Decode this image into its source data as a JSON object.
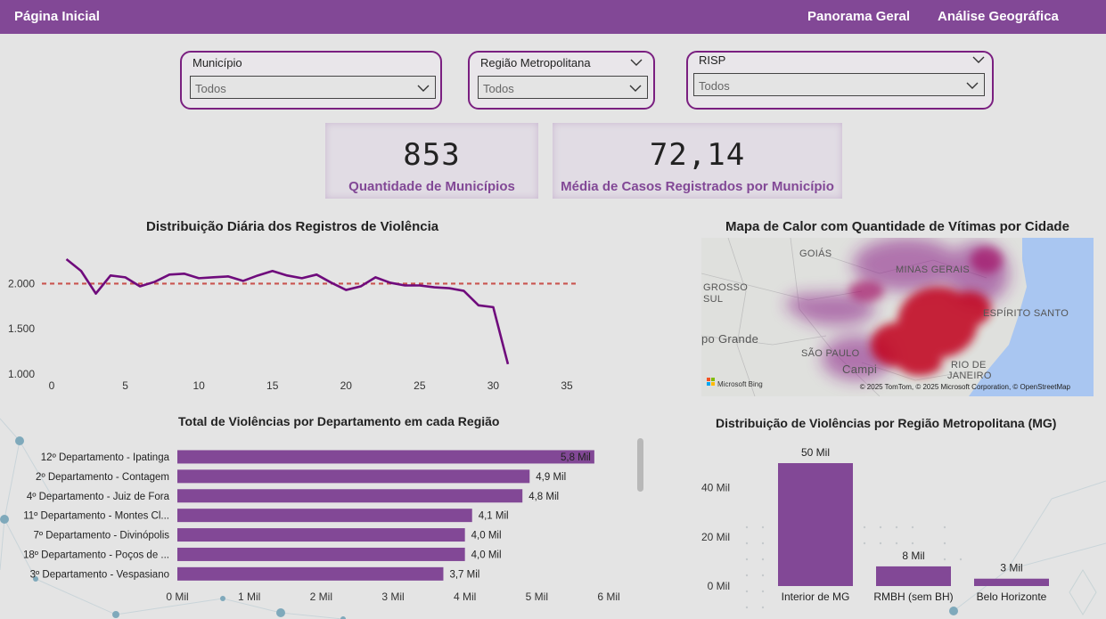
{
  "nav": {
    "home": "Página Inicial",
    "overview": "Panorama Geral",
    "geo": "Análise Geográfica"
  },
  "filters": {
    "municipio": {
      "title": "Município",
      "value": "Todos"
    },
    "regiao": {
      "title": "Região Metropolitana",
      "value": "Todos"
    },
    "risp": {
      "title": "RISP",
      "value": "Todos"
    }
  },
  "cards": {
    "municipios": {
      "value": "853",
      "label": "Quantidade de Municípios"
    },
    "media": {
      "value": "72,14",
      "label": "Média de Casos Registrados por Município"
    }
  },
  "line_chart": {
    "title": "Distribuição Diária dos Registros de Violência"
  },
  "map": {
    "title": "Mapa de Calor com Quantidade de Vítimas por Cidade",
    "labels": [
      "GOIÁS",
      "MINAS GERAIS",
      "GROSSO",
      "SUL",
      "ESPÍRITO SANTO",
      "po Grande",
      "SÃO PAULO",
      "Campi",
      "RIO DE",
      "JANEIRO"
    ],
    "attribution": "© 2025 TomTom, © 2025 Microsoft Corporation, © OpenStreetMap",
    "bing": "Microsoft Bing"
  },
  "bar_chart": {
    "title": "Total de Violências por Departamento em cada Região"
  },
  "column_chart": {
    "title": "Distribuição de Violências por Região Metropolitana (MG)"
  },
  "chart_data": [
    {
      "type": "line",
      "title": "Distribuição Diária dos Registros de Violência",
      "x": [
        1,
        2,
        3,
        4,
        5,
        6,
        7,
        8,
        9,
        10,
        11,
        12,
        13,
        14,
        15,
        16,
        17,
        18,
        19,
        20,
        21,
        22,
        23,
        24,
        25,
        26,
        27,
        28,
        29,
        30,
        31
      ],
      "series": [
        {
          "values": [
            2270,
            2140,
            1890,
            2090,
            2070,
            1970,
            2020,
            2100,
            2110,
            2060,
            2070,
            2080,
            2030,
            2090,
            2140,
            2090,
            2060,
            2100,
            2010,
            1930,
            1970,
            2070,
            2010,
            1980,
            1980,
            1960,
            1950,
            1920,
            1760,
            1740,
            1110
          ]
        }
      ],
      "reference_line": 2000,
      "xlim": [
        0,
        35
      ],
      "xticks": [
        "0",
        "5",
        "10",
        "15",
        "20",
        "25",
        "30",
        "35"
      ],
      "ylim": [
        1000,
        2300
      ],
      "yticks": [
        {
          "v": 1000,
          "label": "1.000"
        },
        {
          "v": 1500,
          "label": "1.500"
        },
        {
          "v": 2000,
          "label": "2.000"
        }
      ],
      "color": "#6f0b7c",
      "ref_color": "#c9544f"
    },
    {
      "type": "bar",
      "orientation": "horizontal",
      "title": "Total de Violências por Departamento em cada Região",
      "categories": [
        "12º Departamento - Ipatinga",
        "2º Departamento - Contagem",
        "4º Departamento - Juiz de Fora",
        "11º Departamento - Montes Cl...",
        "7º Departamento - Divinópolis",
        "18º Departamento - Poços de ...",
        "3º Departamento - Vespasiano"
      ],
      "values": [
        5.8,
        4.9,
        4.8,
        4.1,
        4.0,
        4.0,
        3.7
      ],
      "data_labels": [
        "5,8 Mil",
        "4,9 Mil",
        "4,8 Mil",
        "4,1 Mil",
        "4,0 Mil",
        "4,0 Mil",
        "3,7 Mil"
      ],
      "xlim": [
        0,
        6
      ],
      "xticks": [
        "0 Mil",
        "1 Mil",
        "2 Mil",
        "3 Mil",
        "4 Mil",
        "5 Mil",
        "6 Mil"
      ],
      "color": "#824896"
    },
    {
      "type": "bar",
      "title": "Distribuição de Violências por Região Metropolitana (MG)",
      "categories": [
        "Interior de MG",
        "RMBH (sem BH)",
        "Belo Horizonte"
      ],
      "values": [
        50,
        8,
        3
      ],
      "data_labels": [
        "50 Mil",
        "8 Mil",
        "3 Mil"
      ],
      "ylim": [
        0,
        50
      ],
      "yticks": [
        {
          "v": 0,
          "label": "0 Mil"
        },
        {
          "v": 20,
          "label": "20 Mil"
        },
        {
          "v": 40,
          "label": "40 Mil"
        }
      ],
      "color": "#824896"
    }
  ]
}
